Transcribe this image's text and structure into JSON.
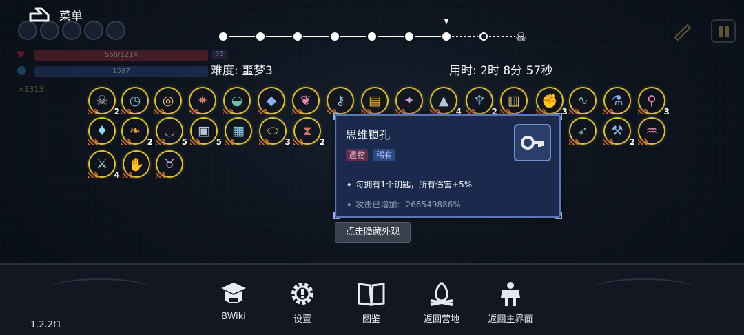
{
  "menu": {
    "label": "菜单"
  },
  "hud": {
    "hp": "568/1214",
    "mp": "1597",
    "level": "93",
    "gold": "×1313"
  },
  "difficulty": "难度: 噩梦3",
  "time": "用时: 2时 8分 57秒",
  "progress": {
    "completed_nodes": 7,
    "total_nodes": 9,
    "current_node": 7,
    "final_icon": "skull-icon"
  },
  "relics": [
    {
      "id": "r1",
      "icon": "mask-icon",
      "count": "2"
    },
    {
      "id": "r2",
      "icon": "clock-icon",
      "count": ""
    },
    {
      "id": "r3",
      "icon": "glasses-icon",
      "count": ""
    },
    {
      "id": "r4",
      "icon": "spiked-shell-icon",
      "count": ""
    },
    {
      "id": "r5",
      "icon": "sub-icon",
      "count": ""
    },
    {
      "id": "r6",
      "icon": "crystal-icon",
      "count": ""
    },
    {
      "id": "r7",
      "icon": "brain-icon",
      "count": ""
    },
    {
      "id": "r8",
      "icon": "key-icon",
      "count": ""
    },
    {
      "id": "r9",
      "icon": "scroll-icon",
      "count": ""
    },
    {
      "id": "r10",
      "icon": "shard-icon",
      "count": ""
    },
    {
      "id": "r11",
      "icon": "cone-icon",
      "count": "4"
    },
    {
      "id": "r12",
      "icon": "jellyfish-icon",
      "count": "2"
    },
    {
      "id": "r13",
      "icon": "battery-icon",
      "count": ""
    },
    {
      "id": "r14",
      "icon": "arm-icon",
      "count": "3"
    },
    {
      "id": "r15",
      "icon": "tentacle-icon",
      "count": ""
    },
    {
      "id": "r16",
      "icon": "potion-icon",
      "count": ""
    },
    {
      "id": "r17",
      "icon": "magnifier-icon",
      "count": "3"
    },
    {
      "id": "r18",
      "icon": "diamond-icon",
      "count": ""
    },
    {
      "id": "r19",
      "icon": "leaf-icon",
      "count": "2"
    },
    {
      "id": "r20",
      "icon": "cloth-icon",
      "count": "5"
    },
    {
      "id": "r21",
      "icon": "cube-icon",
      "count": "5"
    },
    {
      "id": "r22",
      "icon": "chest-icon",
      "count": ""
    },
    {
      "id": "r23",
      "icon": "mirror-icon",
      "count": "3"
    },
    {
      "id": "r24",
      "icon": "hourglass-icon",
      "count": "2"
    },
    {
      "id": "r25",
      "icon": "bow-icon",
      "count": ""
    },
    {
      "id": "r26",
      "icon": "pickaxe-icon",
      "count": "2"
    },
    {
      "id": "r27",
      "icon": "claw-icon",
      "count": ""
    },
    {
      "id": "r28",
      "icon": "sword-icon",
      "count": "4"
    },
    {
      "id": "r29",
      "icon": "gauntlet-icon",
      "count": ""
    },
    {
      "id": "r30",
      "icon": "demon-icon",
      "count": ""
    }
  ],
  "tooltip": {
    "title": "思维锁孔",
    "tag_type": "遗物",
    "tag_rarity": "稀有",
    "effect": "每拥有1个钥匙，所有伤害+5%",
    "stat": "攻击已增加: -266549886%",
    "icon": "key-icon"
  },
  "hide_button": "点击隐藏外观",
  "nav": [
    {
      "label": "BWiki",
      "icon": "graduation-cap-icon"
    },
    {
      "label": "设置",
      "icon": "gear-icon"
    },
    {
      "label": "图鉴",
      "icon": "book-icon"
    },
    {
      "label": "返回营地",
      "icon": "campfire-icon"
    },
    {
      "label": "返回主界面",
      "icon": "statue-icon"
    }
  ],
  "version": "1.2.2f1",
  "colors": {
    "relic_border": "#d8c042",
    "tooltip_bg": "#1b2a4c",
    "tooltip_border": "#5a78b8",
    "tag_relic": "#5a2f4a",
    "tag_rare": "#2c4880"
  }
}
